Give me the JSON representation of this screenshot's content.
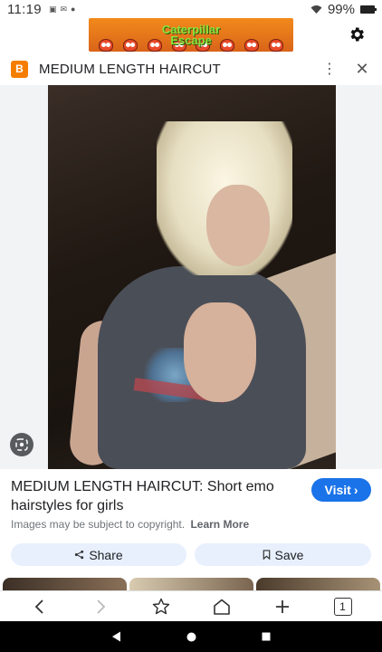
{
  "status_bar": {
    "time": "11:19",
    "battery": "99%"
  },
  "ad": {
    "title_line1": "Caterpillar",
    "title_line2": "Escape"
  },
  "header": {
    "title": "MEDIUM LENGTH HAIRCUT",
    "site_icon": "blogger-icon",
    "site_icon_letter": "B"
  },
  "result": {
    "title": "MEDIUM LENGTH HAIRCUT: Short emo hairstyles for girls",
    "visit_label": "Visit",
    "copyright_text": "Images may be subject to copyright.",
    "learn_more": "Learn More",
    "share_label": "Share",
    "save_label": "Save"
  },
  "toolbar": {
    "tab_count": "1"
  },
  "colors": {
    "accent": "#1a73e8",
    "chip_bg": "#e8f0fe",
    "blogger": "#f57d00"
  }
}
